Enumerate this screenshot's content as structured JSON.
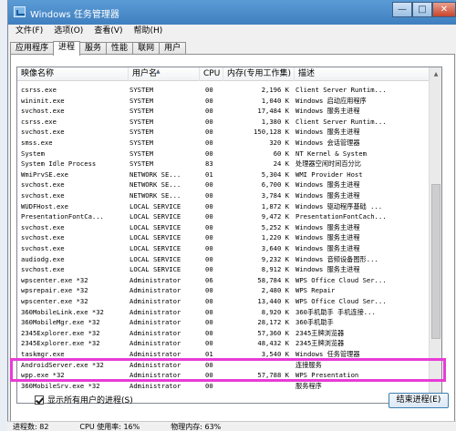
{
  "window": {
    "title": "Windows 任务管理器",
    "min_glyph": "—",
    "max_glyph": "□",
    "close_glyph": "✕"
  },
  "menu": [
    "文件(F)",
    "选项(O)",
    "查看(V)",
    "帮助(H)"
  ],
  "tabs": [
    "应用程序",
    "进程",
    "服务",
    "性能",
    "联网",
    "用户"
  ],
  "active_tab": "进程",
  "columns": {
    "name": "映像名称",
    "user": "用户名",
    "cpu": "CPU",
    "mem": "内存(专用工作集)",
    "desc": "描述"
  },
  "processes": [
    {
      "name": "csrss.exe",
      "user": "SYSTEM",
      "cpu": "00",
      "mem": "2,196 K",
      "desc": "Client Server Runtim..."
    },
    {
      "name": "wininit.exe",
      "user": "SYSTEM",
      "cpu": "00",
      "mem": "1,040 K",
      "desc": "Windows 启动应用程序"
    },
    {
      "name": "svchost.exe",
      "user": "SYSTEM",
      "cpu": "00",
      "mem": "17,484 K",
      "desc": "Windows 服务主进程"
    },
    {
      "name": "csrss.exe",
      "user": "SYSTEM",
      "cpu": "00",
      "mem": "1,380 K",
      "desc": "Client Server Runtim..."
    },
    {
      "name": "svchost.exe",
      "user": "SYSTEM",
      "cpu": "00",
      "mem": "150,128 K",
      "desc": "Windows 服务主进程"
    },
    {
      "name": "smss.exe",
      "user": "SYSTEM",
      "cpu": "00",
      "mem": "320 K",
      "desc": "Windows 会话管理器"
    },
    {
      "name": "System",
      "user": "SYSTEM",
      "cpu": "00",
      "mem": "60 K",
      "desc": "NT Kernel & System"
    },
    {
      "name": "System Idle Process",
      "user": "SYSTEM",
      "cpu": "83",
      "mem": "24 K",
      "desc": "处理器空闲时间百分比"
    },
    {
      "name": "WmiPrvSE.exe",
      "user": "NETWORK SE...",
      "cpu": "01",
      "mem": "5,304 K",
      "desc": "WMI Provider Host"
    },
    {
      "name": "svchost.exe",
      "user": "NETWORK SE...",
      "cpu": "00",
      "mem": "6,700 K",
      "desc": "Windows 服务主进程"
    },
    {
      "name": "svchost.exe",
      "user": "NETWORK SE...",
      "cpu": "00",
      "mem": "3,784 K",
      "desc": "Windows 服务主进程"
    },
    {
      "name": "WUDFHost.exe",
      "user": "LOCAL SERVICE",
      "cpu": "00",
      "mem": "1,872 K",
      "desc": "Windows 驱动程序基础 ..."
    },
    {
      "name": "PresentationFontCa...",
      "user": "LOCAL SERVICE",
      "cpu": "00",
      "mem": "9,472 K",
      "desc": "PresentationFontCach..."
    },
    {
      "name": "svchost.exe",
      "user": "LOCAL SERVICE",
      "cpu": "00",
      "mem": "5,252 K",
      "desc": "Windows 服务主进程"
    },
    {
      "name": "svchost.exe",
      "user": "LOCAL SERVICE",
      "cpu": "00",
      "mem": "1,220 K",
      "desc": "Windows 服务主进程"
    },
    {
      "name": "svchost.exe",
      "user": "LOCAL SERVICE",
      "cpu": "00",
      "mem": "3,640 K",
      "desc": "Windows 服务主进程"
    },
    {
      "name": "audiodg.exe",
      "user": "LOCAL SERVICE",
      "cpu": "00",
      "mem": "9,232 K",
      "desc": "Windows 音频设备图形..."
    },
    {
      "name": "svchost.exe",
      "user": "LOCAL SERVICE",
      "cpu": "00",
      "mem": "8,912 K",
      "desc": "Windows 服务主进程"
    },
    {
      "name": "wpscenter.exe *32",
      "user": "Administrator",
      "cpu": "06",
      "mem": "58,784 K",
      "desc": "WPS Office Cloud Ser..."
    },
    {
      "name": "wpsrepair.exe *32",
      "user": "Administrator",
      "cpu": "00",
      "mem": "2,480 K",
      "desc": "WPS Repair"
    },
    {
      "name": "wpscenter.exe *32",
      "user": "Administrator",
      "cpu": "00",
      "mem": "13,440 K",
      "desc": "WPS Office Cloud Ser..."
    },
    {
      "name": "360MobileLink.exe *32",
      "user": "Administrator",
      "cpu": "00",
      "mem": "8,920 K",
      "desc": "360手机助手 手机连接..."
    },
    {
      "name": "360MobileMgr.exe *32",
      "user": "Administrator",
      "cpu": "00",
      "mem": "28,172 K",
      "desc": "360手机助手"
    },
    {
      "name": "2345Explorer.exe *32",
      "user": "Administrator",
      "cpu": "00",
      "mem": "57,360 K",
      "desc": "2345王牌浏览器"
    },
    {
      "name": "2345Explorer.exe *32",
      "user": "Administrator",
      "cpu": "00",
      "mem": "48,432 K",
      "desc": "2345王牌浏览器"
    },
    {
      "name": "taskmgr.exe",
      "user": "Administrator",
      "cpu": "01",
      "mem": "3,540 K",
      "desc": "Windows 任务管理器"
    },
    {
      "name": "AndroidServer.exe *32",
      "user": "Administrator",
      "cpu": "00",
      "mem": "",
      "desc": "连接服务"
    },
    {
      "name": "wpp.exe *32",
      "user": "Administrator",
      "cpu": "00",
      "mem": "57,788 K",
      "desc": "WPS Presentation"
    },
    {
      "name": "360MobileSrv.exe *32",
      "user": "Administrator",
      "cpu": "00",
      "mem": "",
      "desc": "服务程序"
    }
  ],
  "show_all_users_label": "显示所有用户的进程(S)",
  "end_process_label": "结束进程(E)",
  "status": {
    "processes": "进程数: 82",
    "cpu": "CPU 使用率: 16%",
    "memory": "物理内存: 63%"
  },
  "colors": {
    "highlight": "#e83bd6",
    "titlebar": "#4a8ccb"
  }
}
